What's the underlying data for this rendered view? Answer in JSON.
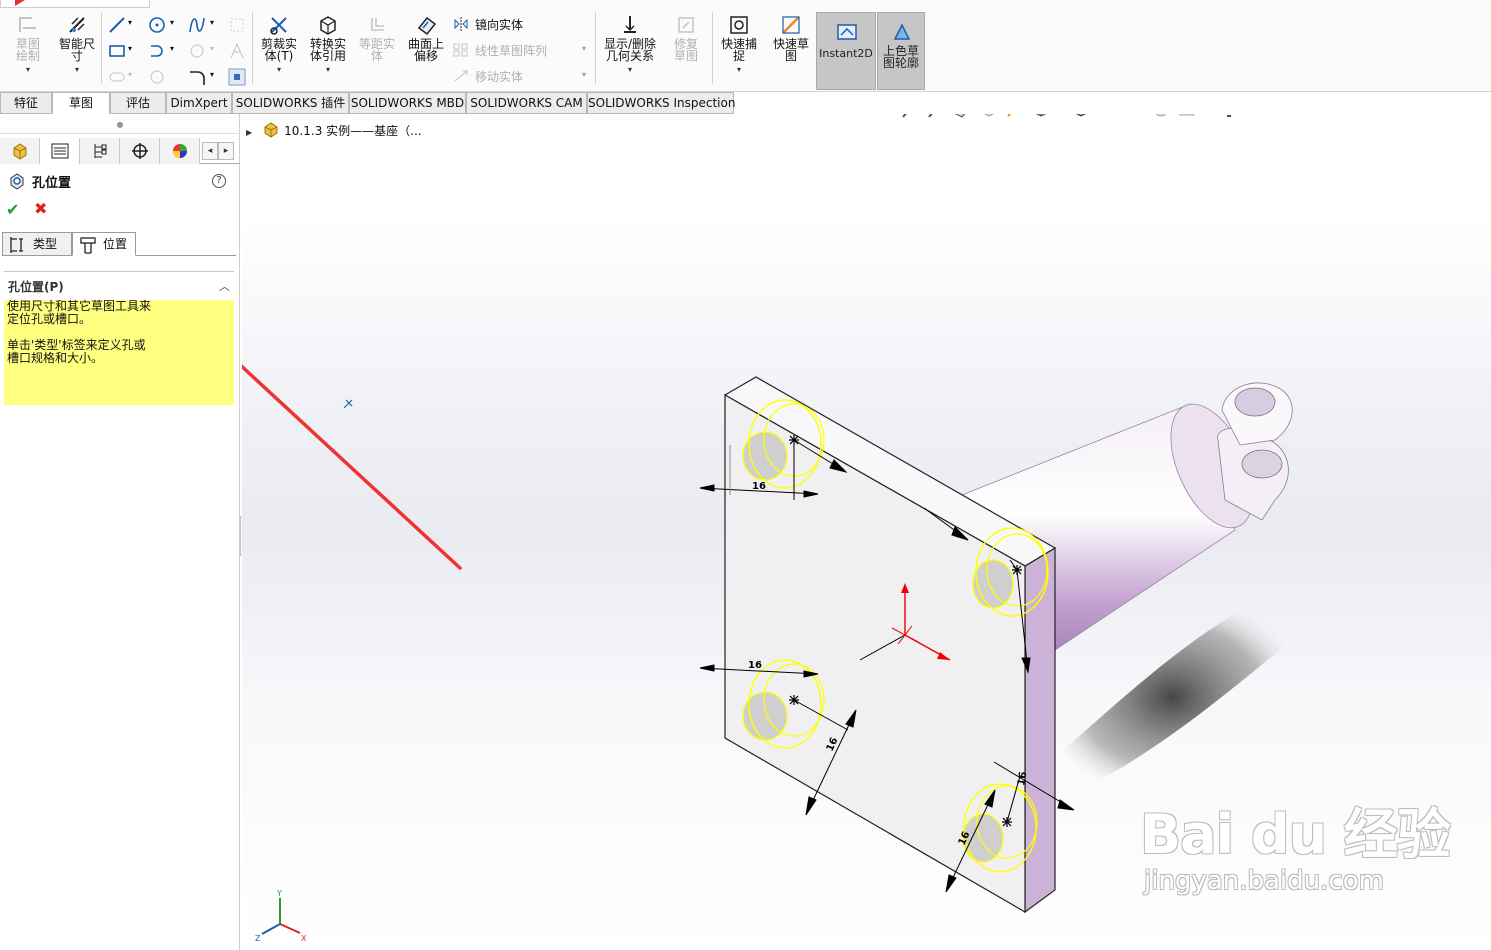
{
  "ribbon": {
    "sketch_entities": "草图绘制",
    "smart_dimension": "智能尺寸",
    "trim": "剪裁实体(T)",
    "convert": "转换实体引用",
    "offset": "等距实体",
    "offset_surface": "曲面上偏移",
    "mirror": "镜向实体",
    "linear_pattern": "线性草图阵列",
    "move": "移动实体",
    "relations": "显示/删除几何关系",
    "repair": "修复草图",
    "quick_snaps": "快速捕捉",
    "rapid_sketch": "快速草图",
    "instant2d": "Instant2D",
    "shaded_contours": "上色草图轮廓"
  },
  "tabs": [
    "特征",
    "草图",
    "评估",
    "DimXpert",
    "SOLIDWORKS 插件",
    "SOLIDWORKS MBD",
    "SOLIDWORKS CAM",
    "SOLIDWORKS Inspection"
  ],
  "panel": {
    "title": "孔位置",
    "help": "?",
    "ok": "✔",
    "cancel": "✖",
    "tab_type": "类型",
    "tab_position": "位置",
    "group_title": "孔位置(P)",
    "message_line1": "使用尺寸和其它草图工具来定位孔或槽口。",
    "message_line2": "单击'类型'标签来定义孔或槽口规格和大小。"
  },
  "tree": {
    "item": "10.1.3  实例——基座（..."
  },
  "dimensions": [
    "16",
    "16",
    "16",
    "16",
    "16"
  ],
  "watermark": {
    "brand": "Bai du 经验",
    "url": "jingyan.baidu.com"
  },
  "triad": {
    "x": "X",
    "y": "Y",
    "z": "Z"
  },
  "colors": {
    "highlight_yellow": "#ffff80",
    "ok_green": "#2a9a2a",
    "cancel_red": "#dd2222",
    "arrow_red": "#ee3333",
    "part_lilac": "#c8a9d6"
  },
  "icons": [
    "sketch-icon",
    "smart-dimension-icon",
    "line-icon",
    "rectangle-icon",
    "circle-icon",
    "arc-icon",
    "spline-icon",
    "trim-icon",
    "convert-icon",
    "mirror-icon",
    "relations-icon",
    "snap-icon",
    "rapid-sketch-icon",
    "instant2d-icon",
    "shaded-contour-icon",
    "feature-manager-icon",
    "property-manager-icon",
    "config-manager-icon",
    "dimxpert-manager-icon",
    "appearance-icon",
    "hole-position-icon",
    "zoom-icon",
    "view-orientation-icon"
  ]
}
